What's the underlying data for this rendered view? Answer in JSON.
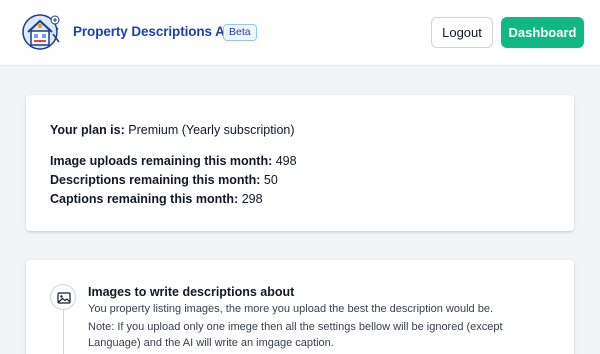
{
  "header": {
    "brand": "Property Descriptions AI",
    "badge": "Beta",
    "logout_label": "Logout",
    "dashboard_label": "Dashboard"
  },
  "plan": {
    "plan_label": "Your plan is:",
    "plan_value": "Premium (Yearly subscription)",
    "images_label": "Image uploads remaining this month:",
    "images_value": "498",
    "descriptions_label": "Descriptions remaining this month:",
    "descriptions_value": "50",
    "captions_label": "Captions remaining this month:",
    "captions_value": "298"
  },
  "images_section": {
    "icon": "image-icon",
    "title": "Images to write descriptions about",
    "text": "You property listing images, the more you upload the best the description would be.",
    "note_line1": "Note: If you upload only one imege then all the settings bellow will be ignored (except",
    "note_line2": "Language) and the AI will write an imgage caption."
  },
  "colors": {
    "brand": "#1e40af",
    "dashboard_button": "#10b981",
    "page_background": "#f3f4f6"
  }
}
